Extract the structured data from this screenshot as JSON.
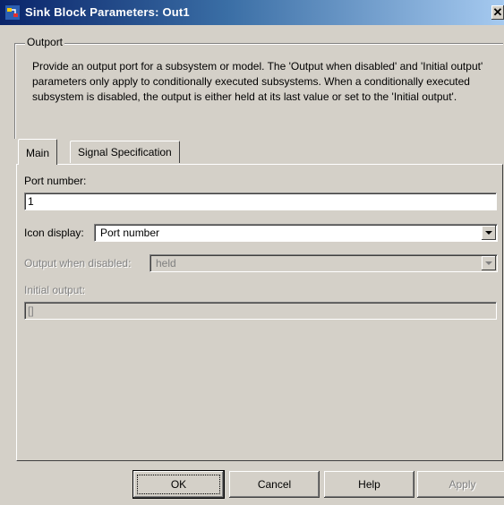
{
  "window": {
    "title": "Sink Block Parameters: Out1",
    "close_glyph": "✕"
  },
  "group": {
    "legend": "Outport",
    "description": "Provide an output port for a subsystem or model.  The 'Output when disabled' and 'Initial output' parameters only apply to conditionally executed subsystems. When a conditionally executed subsystem is disabled, the output is either held at its last value or set to the 'Initial output'."
  },
  "tabs": [
    {
      "label": "Main",
      "selected": true
    },
    {
      "label": "Signal Specification",
      "selected": false
    }
  ],
  "form": {
    "port_number_label": "Port number:",
    "port_number_value": "1",
    "icon_display_label": "Icon display:",
    "icon_display_value": "Port number",
    "output_disabled_label": "Output when disabled:",
    "output_disabled_value": "held",
    "initial_output_label": "Initial output:",
    "initial_output_value": "[]"
  },
  "buttons": {
    "ok": "OK",
    "cancel": "Cancel",
    "help": "Help",
    "apply": "Apply"
  },
  "colors": {
    "title_start": "#0a246a",
    "title_end": "#a6caf0",
    "face": "#d4d0c8"
  }
}
